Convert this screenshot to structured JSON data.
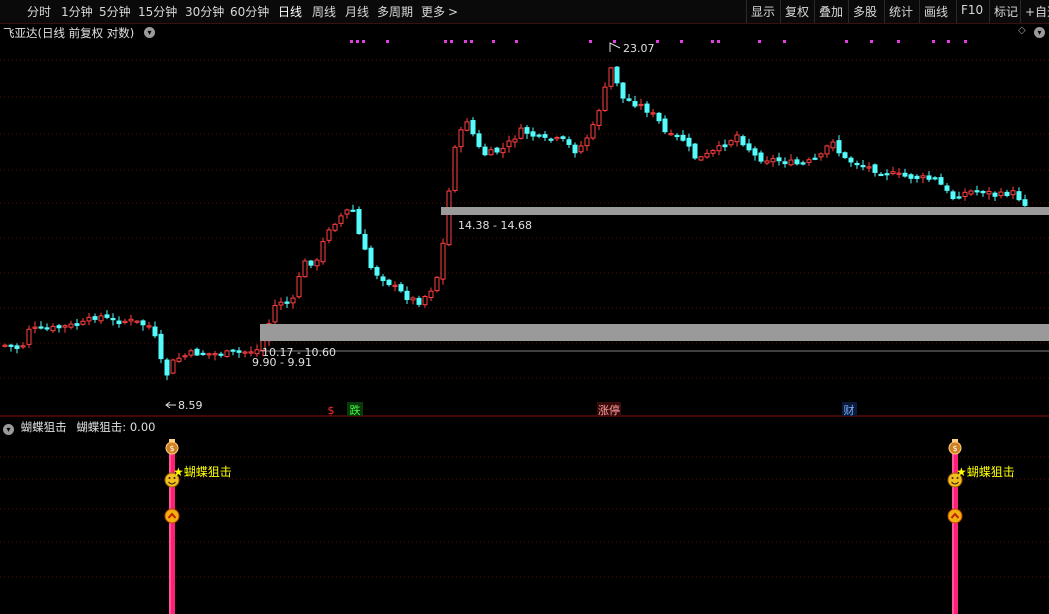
{
  "toolbar": {
    "left_items": [
      "分时",
      "1分钟",
      "5分钟",
      "15分钟",
      "30分钟",
      "60分钟",
      "日线",
      "周线",
      "月线",
      "多周期",
      "更多"
    ],
    "more_arrow": ">",
    "active": "日线",
    "right_items": [
      "显示",
      "复权",
      "叠加",
      "多股",
      "统计",
      "画线",
      "F10",
      "标记",
      "+自选"
    ]
  },
  "chart": {
    "title": "飞亚达(日线 前复权 对数)",
    "price_high_label": "23.07",
    "price_low_label": "8.59",
    "zone_upper_label": "14.38 - 14.68",
    "zone_lower_label_a": "10.17 - 10.60",
    "zone_lower_label_b": "9.90 - 9.91",
    "event_dollar": "$",
    "event_fall": "跌",
    "event_limit_up": "涨停",
    "event_finance": "财",
    "colors": {
      "up": "#ff4040",
      "down": "#54fcfc",
      "zone": "#9a9a9a",
      "signal": "#ff1e78",
      "marker": "#e040e0"
    }
  },
  "indicator": {
    "title_name": "蝴蝶狙击",
    "value_label": "蝴蝶狙击: 0.00",
    "signal_label": "★蝴蝶狙击",
    "icons": [
      "money-bag-icon",
      "smiley-icon",
      "up-chevron-icon"
    ]
  }
}
